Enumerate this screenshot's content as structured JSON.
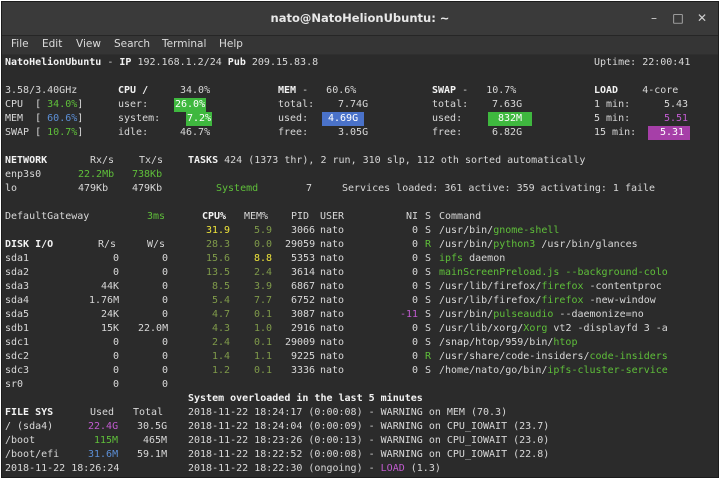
{
  "window": {
    "title": "nato@NatoHelionUbuntu: ~"
  },
  "menu": [
    "File",
    "Edit",
    "View",
    "Search",
    "Terminal",
    "Help"
  ],
  "header": {
    "host": "NatoHelionUbuntu",
    "ip_label": "IP",
    "ip": "192.168.1.2/24",
    "pub_label": "Pub",
    "pub": "209.15.83.8",
    "uptime_label": "Uptime:",
    "uptime": "22:00:41"
  },
  "cpu": {
    "freq": "3.58/3.40GHz",
    "label": "CPU",
    "total": "34.0%",
    "user_label": "user:",
    "user": "26.0%",
    "system_label": "system:",
    "system": "7.2%",
    "idle_label": "idle:",
    "idle": "46.7%",
    "quick_cpu_label": "CPU",
    "quick_cpu": "34.0%",
    "quick_mem_label": "MEM",
    "quick_mem": "60.6%",
    "quick_swap_label": "SWAP",
    "quick_swap": "10.7%"
  },
  "mem": {
    "label": "MEM",
    "pct": "60.6%",
    "total_label": "total:",
    "total": "7.74G",
    "used_label": "used:",
    "used": "4.69G",
    "free_label": "free:",
    "free": "3.05G"
  },
  "swap": {
    "label": "SWAP",
    "pct": "10.7%",
    "total_label": "total:",
    "total": "7.63G",
    "used_label": "used:",
    "used": "832M",
    "free_label": "free:",
    "free": "6.82G"
  },
  "load": {
    "label": "LOAD",
    "cores": "4-core",
    "m1_label": "1 min:",
    "m1": "5.43",
    "m5_label": "5 min:",
    "m5": "5.51",
    "m15_label": "15 min:",
    "m15": "5.31"
  },
  "network": {
    "label": "NETWORK",
    "rx_label": "Rx/s",
    "tx_label": "Tx/s",
    "rows": [
      {
        "iface": "enp3s0",
        "rx": "22.2Mb",
        "tx": "738Kb"
      },
      {
        "iface": "lo",
        "rx": "479Kb",
        "tx": "479Kb"
      }
    ]
  },
  "tasks": {
    "label": "TASKS",
    "summary": "424 (1373 thr), 2 run, 310 slp, 112 oth sorted automatically",
    "systemd": "Systemd",
    "systemd_count": "7",
    "services": "Services loaded: 361 active: 359 activating: 1 faile"
  },
  "gateway": {
    "label": "DefaultGateway",
    "value": "3ms"
  },
  "proc_header": {
    "cpu": "CPU%",
    "mem": "MEM%",
    "pid": "PID",
    "user": "USER",
    "ni": "NI",
    "s": "S",
    "cmd": "Command"
  },
  "processes": [
    {
      "cpu": "31.9",
      "mem": "5.9",
      "pid": "3066",
      "user": "nato",
      "ni": "0",
      "s": "S",
      "path": "/usr/bin/",
      "name": "gnome-shell",
      "args": ""
    },
    {
      "cpu": "28.3",
      "mem": "0.0",
      "pid": "29059",
      "user": "nato",
      "ni": "0",
      "s": "R",
      "path": "/usr/bin/",
      "name": "python3",
      "args": " /usr/bin/glances"
    },
    {
      "cpu": "15.6",
      "mem": "8.8",
      "pid": "5353",
      "user": "nato",
      "ni": "0",
      "s": "S",
      "path": "",
      "name": "ipfs",
      "args": " daemon"
    },
    {
      "cpu": "13.5",
      "mem": "2.4",
      "pid": "3614",
      "user": "nato",
      "ni": "0",
      "s": "S",
      "path": "",
      "name": "mainScreenPreload.js --background-colo",
      "args": ""
    },
    {
      "cpu": "8.5",
      "mem": "3.9",
      "pid": "6867",
      "user": "nato",
      "ni": "0",
      "s": "S",
      "path": "/usr/lib/firefox/",
      "name": "firefox",
      "args": " -contentproc"
    },
    {
      "cpu": "5.4",
      "mem": "7.7",
      "pid": "6752",
      "user": "nato",
      "ni": "0",
      "s": "S",
      "path": "/usr/lib/firefox/",
      "name": "firefox",
      "args": " -new-window"
    },
    {
      "cpu": "4.7",
      "mem": "0.1",
      "pid": "3087",
      "user": "nato",
      "ni": "-11",
      "s": "S",
      "path": "/usr/bin/",
      "name": "pulseaudio",
      "args": " --daemonize=no"
    },
    {
      "cpu": "4.3",
      "mem": "1.0",
      "pid": "2916",
      "user": "nato",
      "ni": "0",
      "s": "S",
      "path": "/usr/lib/xorg/",
      "name": "Xorg",
      "args": " vt2 -displayfd 3 -a"
    },
    {
      "cpu": "2.4",
      "mem": "0.1",
      "pid": "29009",
      "user": "nato",
      "ni": "0",
      "s": "S",
      "path": "/snap/htop/959/bin/",
      "name": "htop",
      "args": ""
    },
    {
      "cpu": "1.4",
      "mem": "1.1",
      "pid": "9225",
      "user": "nato",
      "ni": "0",
      "s": "R",
      "path": "/usr/share/code-insiders/",
      "name": "code-insiders",
      "args": ""
    },
    {
      "cpu": "1.2",
      "mem": "0.1",
      "pid": "3336",
      "user": "nato",
      "ni": "0",
      "s": "S",
      "path": "/home/nato/go/bin/",
      "name": "ipfs-cluster-service",
      "args": ""
    }
  ],
  "disk": {
    "label": "DISK I/O",
    "r_label": "R/s",
    "w_label": "W/s",
    "rows": [
      {
        "name": "sda1",
        "r": "0",
        "w": "0"
      },
      {
        "name": "sda2",
        "r": "0",
        "w": "0"
      },
      {
        "name": "sda3",
        "r": "44K",
        "w": "0"
      },
      {
        "name": "sda4",
        "r": "1.76M",
        "w": "0"
      },
      {
        "name": "sda5",
        "r": "24K",
        "w": "0"
      },
      {
        "name": "sdb1",
        "r": "15K",
        "w": "22.0M"
      },
      {
        "name": "sdc1",
        "r": "0",
        "w": "0"
      },
      {
        "name": "sdc2",
        "r": "0",
        "w": "0"
      },
      {
        "name": "sdc3",
        "r": "0",
        "w": "0"
      },
      {
        "name": "sr0",
        "r": "0",
        "w": "0"
      }
    ]
  },
  "fs": {
    "label": "FILE SYS",
    "used_label": "Used",
    "total_label": "Total",
    "rows": [
      {
        "name": "/ (sda4)",
        "used": "22.4G",
        "total": "30.5G"
      },
      {
        "name": "/boot",
        "used": "115M",
        "total": "465M"
      },
      {
        "name": "/boot/efi",
        "used": "31.6M",
        "total": "59.1M"
      }
    ]
  },
  "alerts": {
    "title": "System overloaded in the last 5 minutes",
    "rows": [
      {
        "time": "2018-11-22 18:24:17 (0:00:08)",
        "text": " - WARNING on MEM (70.3)",
        "key": ""
      },
      {
        "time": "2018-11-22 18:24:04 (0:00:09)",
        "text": " - WARNING on CPU_IOWAIT (23.7)",
        "key": ""
      },
      {
        "time": "2018-11-22 18:23:26 (0:00:13)",
        "text": " - WARNING on CPU_IOWAIT (23.0)",
        "key": ""
      },
      {
        "time": "2018-11-22 18:22:52 (0:00:08)",
        "text": " - WARNING on CPU_IOWAIT (22.8)",
        "key": ""
      },
      {
        "time": "2018-11-22 18:22:30 (ongoing)",
        "text": " - ",
        "key": "LOAD",
        "tail": " (1.3)"
      }
    ]
  },
  "footer_time": "2018-11-22 18:26:24",
  "colors": {
    "bg": "#2b2b2b",
    "green": "#5fbf3a",
    "box_green": "#3fb83f",
    "box_blue": "#4a72c9",
    "box_magenta": "#a63fa8",
    "magenta": "#c15bd0",
    "yellow": "#ede33a"
  }
}
